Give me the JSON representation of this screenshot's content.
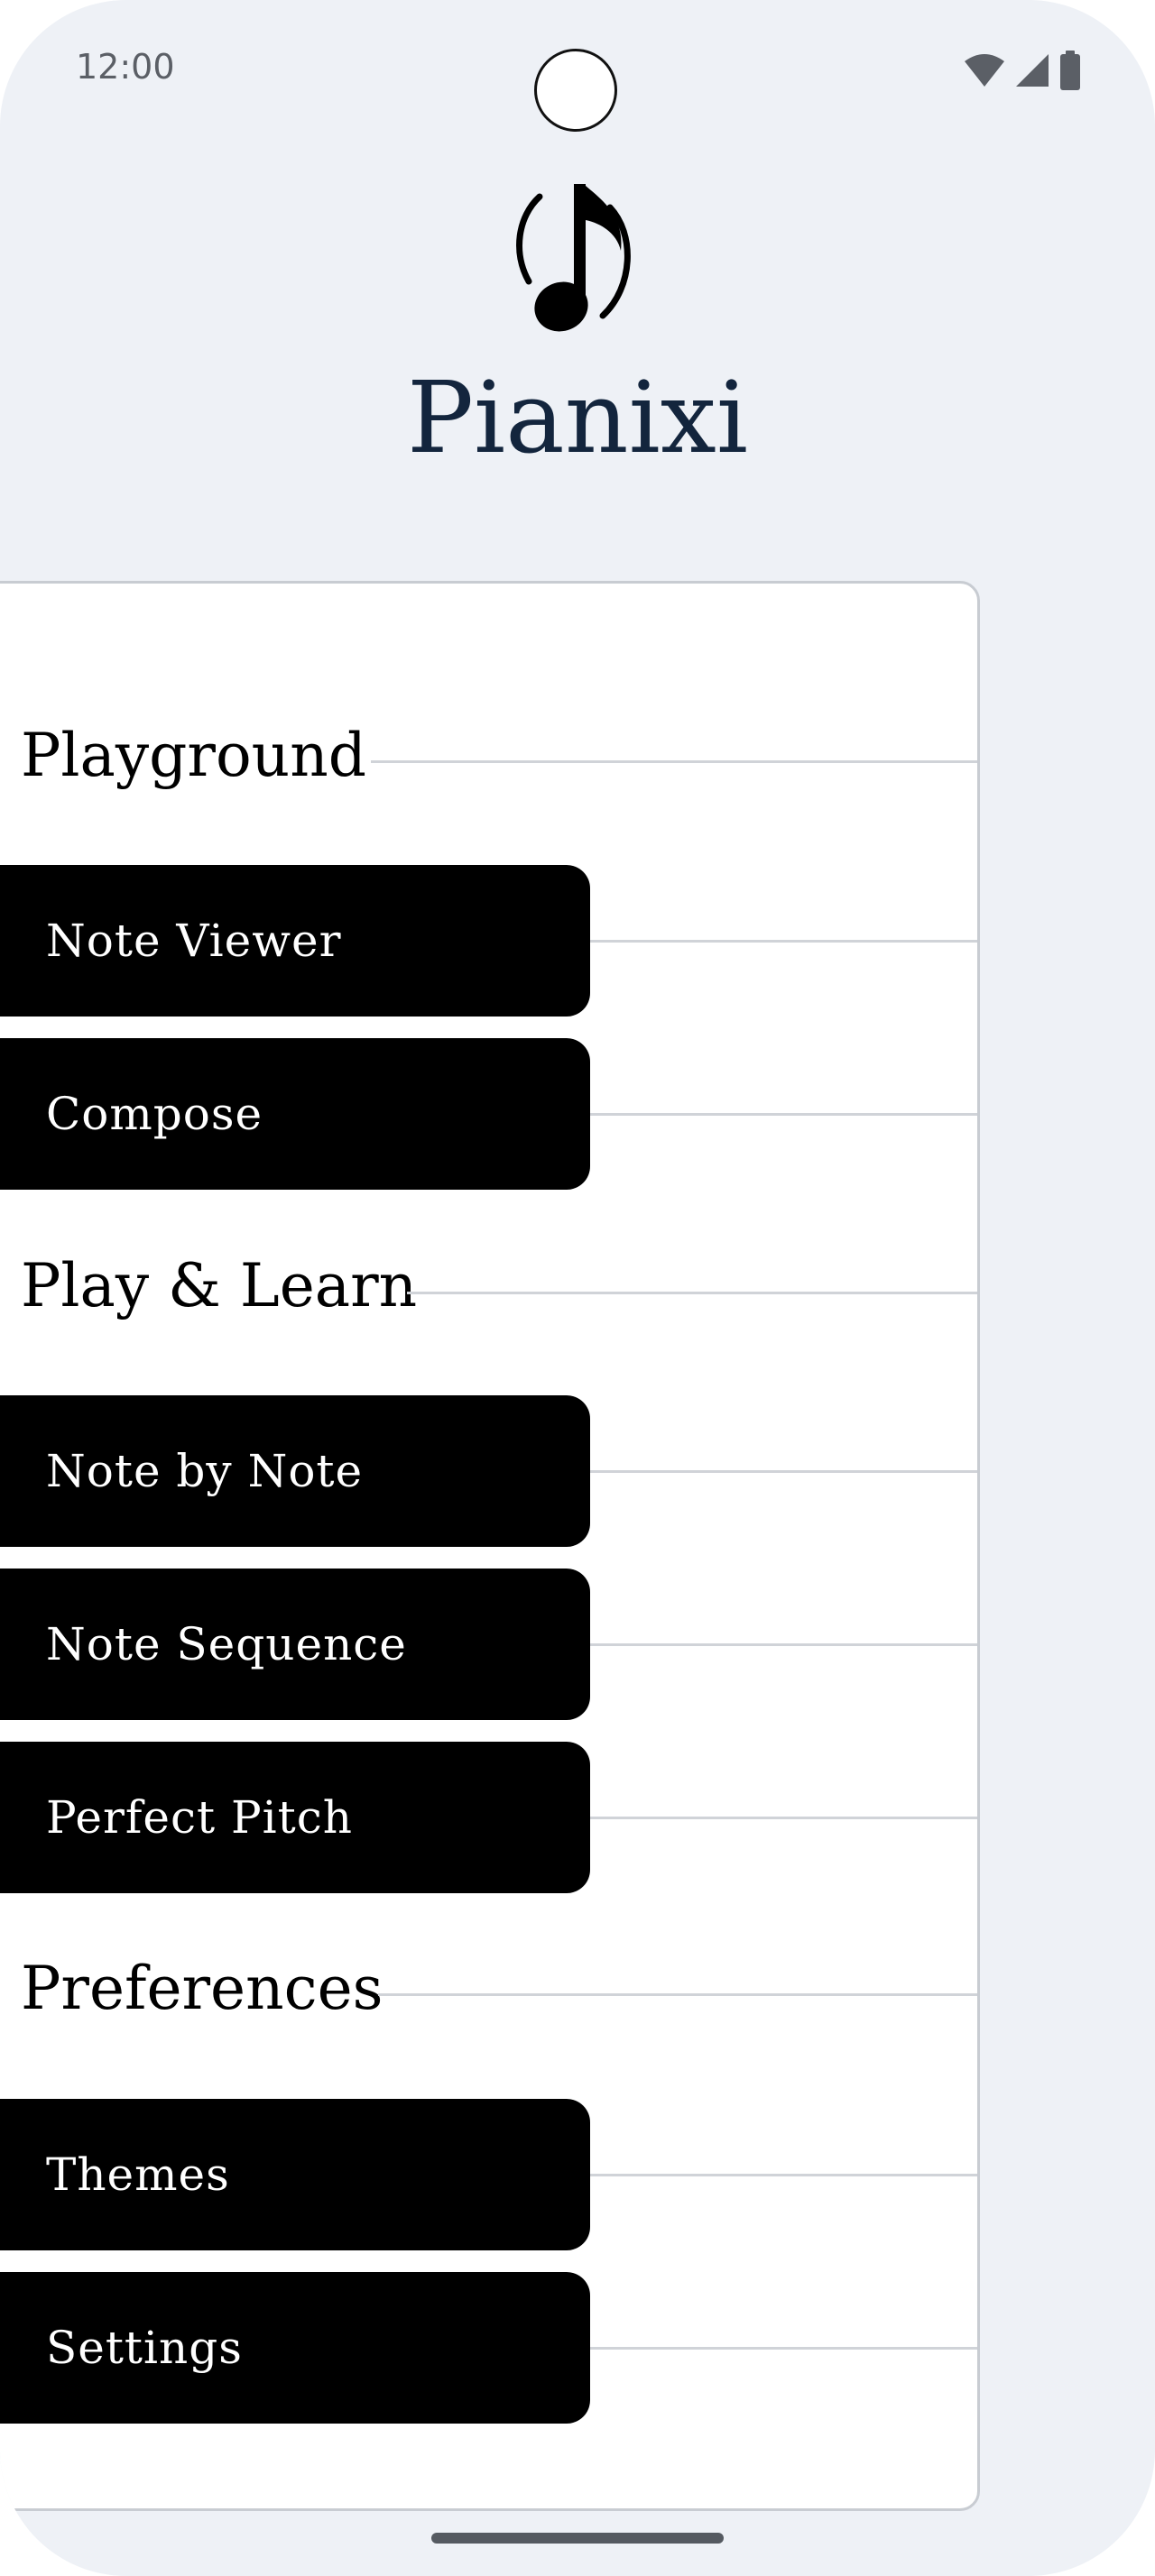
{
  "status_bar": {
    "time": "12:00",
    "icons": [
      "wifi-icon",
      "signal-icon",
      "battery-icon"
    ]
  },
  "app": {
    "logo_icon": "music-note-icon",
    "title": "Pianixi"
  },
  "sections": [
    {
      "header": "Playground",
      "buttons": [
        "Note Viewer",
        "Compose"
      ]
    },
    {
      "header": "Play & Learn",
      "buttons": [
        "Note by Note",
        "Note Sequence",
        "Perfect Pitch"
      ]
    },
    {
      "header": "Preferences",
      "buttons": [
        "Themes",
        "Settings"
      ]
    }
  ],
  "colors": {
    "background": "#eef1f6",
    "title": "#13253d",
    "button": "#000000",
    "button_text": "#ffffff",
    "card": "#ffffff"
  }
}
